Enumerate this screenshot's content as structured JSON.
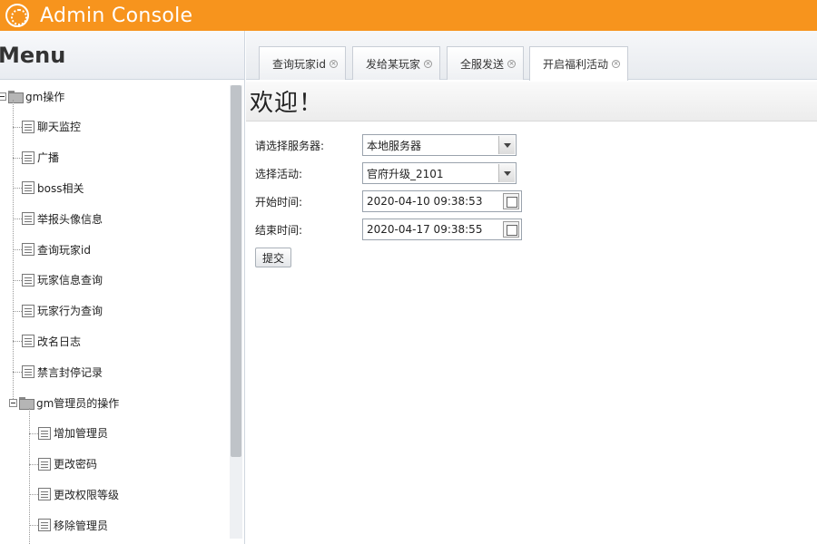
{
  "header": {
    "title": "Admin Console",
    "accent_color": "#f7941d",
    "logo_icon": "orange-slice-icon"
  },
  "sidebar": {
    "title": "Menu",
    "tree": [
      {
        "label": "gm操作",
        "type": "folder",
        "expanded": true,
        "level": 0
      },
      {
        "label": "聊天监控",
        "type": "page",
        "level": 1
      },
      {
        "label": "广播",
        "type": "page",
        "level": 1
      },
      {
        "label": "boss相关",
        "type": "page",
        "level": 1
      },
      {
        "label": "举报头像信息",
        "type": "page",
        "level": 1
      },
      {
        "label": "查询玩家id",
        "type": "page",
        "level": 1
      },
      {
        "label": "玩家信息查询",
        "type": "page",
        "level": 1
      },
      {
        "label": "玩家行为查询",
        "type": "page",
        "level": 1
      },
      {
        "label": "改名日志",
        "type": "page",
        "level": 1
      },
      {
        "label": "禁言封停记录",
        "type": "page",
        "level": 1
      },
      {
        "label": "gm管理员的操作",
        "type": "folder",
        "expanded": true,
        "level": 1
      },
      {
        "label": "增加管理员",
        "type": "page",
        "level": 2
      },
      {
        "label": "更改密码",
        "type": "page",
        "level": 2
      },
      {
        "label": "更改权限等级",
        "type": "page",
        "level": 2
      },
      {
        "label": "移除管理员",
        "type": "page",
        "level": 2
      }
    ]
  },
  "tabs": [
    {
      "label": "查询玩家id",
      "active": false
    },
    {
      "label": "发给某玩家",
      "active": false
    },
    {
      "label": "全服发送",
      "active": false
    },
    {
      "label": "开启福利活动",
      "active": true
    }
  ],
  "main": {
    "welcome": "欢迎！",
    "form": {
      "server_label": "请选择服务器:",
      "server_value": "本地服务器",
      "activity_label": "选择活动:",
      "activity_value": "官府升级_2101",
      "start_label": "开始时间:",
      "start_value": "2020-04-10 09:38:53",
      "end_label": "结束时间:",
      "end_value": "2020-04-17 09:38:55",
      "submit_label": "提交"
    }
  }
}
